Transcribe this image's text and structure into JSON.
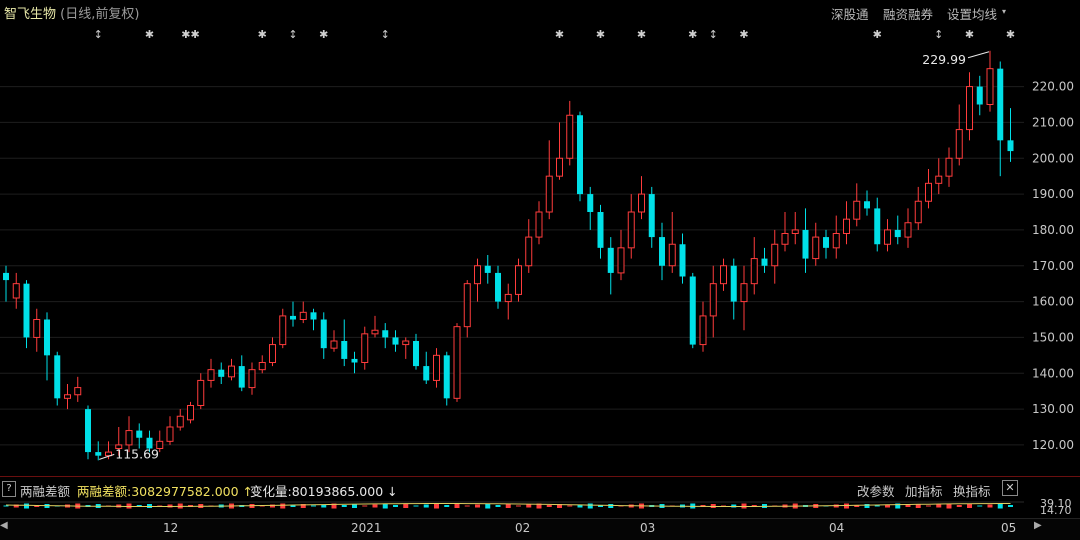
{
  "header": {
    "stock_name": "智飞生物",
    "mode": "(日线,前复权)",
    "links": [
      "深股通",
      "融资融券",
      "设置均线"
    ]
  },
  "chart_data": {
    "type": "candlestick",
    "y_ticks": [
      "220.00",
      "210.00",
      "200.00",
      "190.00",
      "180.00",
      "170.00",
      "160.00",
      "150.00",
      "140.00",
      "130.00",
      "120.00"
    ],
    "ylim": [
      113,
      233
    ],
    "x_labels": [
      "12",
      "2021",
      "02",
      "03",
      "04",
      "05"
    ],
    "high_label": "229.99",
    "low_label": "115.69",
    "event_markers": [
      {
        "index": 9,
        "symbol": "↕"
      },
      {
        "index": 14,
        "symbol": "✱"
      },
      {
        "index": 18,
        "symbol": "✱✱"
      },
      {
        "index": 25,
        "symbol": "✱"
      },
      {
        "index": 28,
        "symbol": "↕"
      },
      {
        "index": 31,
        "symbol": "✱"
      },
      {
        "index": 37,
        "symbol": "↕"
      },
      {
        "index": 54,
        "symbol": "✱"
      },
      {
        "index": 58,
        "symbol": "✱"
      },
      {
        "index": 62,
        "symbol": "✱"
      },
      {
        "index": 67,
        "symbol": "✱"
      },
      {
        "index": 69,
        "symbol": "↕"
      },
      {
        "index": 72,
        "symbol": "✱"
      },
      {
        "index": 85,
        "symbol": "✱"
      },
      {
        "index": 91,
        "symbol": "↕"
      },
      {
        "index": 94,
        "symbol": "✱"
      },
      {
        "index": 98,
        "symbol": "✱"
      }
    ],
    "candles": [
      [
        168,
        166,
        170,
        160
      ],
      [
        161,
        165,
        168,
        158
      ],
      [
        165,
        150,
        166,
        147
      ],
      [
        150,
        155,
        158,
        146
      ],
      [
        155,
        145,
        157,
        138
      ],
      [
        145,
        133,
        146,
        131
      ],
      [
        133,
        134,
        137,
        130
      ],
      [
        134,
        136,
        139,
        132
      ],
      [
        130,
        118,
        131,
        116
      ],
      [
        118,
        117,
        121,
        115.69
      ],
      [
        117,
        118,
        121,
        116
      ],
      [
        119,
        120,
        125,
        117
      ],
      [
        120,
        124,
        128,
        118
      ],
      [
        124,
        122,
        126,
        119
      ],
      [
        122,
        119,
        124,
        118
      ],
      [
        119,
        121,
        124,
        118
      ],
      [
        121,
        125,
        128,
        120
      ],
      [
        125,
        128,
        130,
        124
      ],
      [
        127,
        131,
        132,
        126
      ],
      [
        131,
        138,
        140,
        130
      ],
      [
        138,
        141,
        144,
        136
      ],
      [
        141,
        139,
        143,
        137
      ],
      [
        139,
        142,
        144,
        138
      ],
      [
        142,
        136,
        145,
        135
      ],
      [
        136,
        141,
        143,
        134
      ],
      [
        141,
        143,
        145,
        140
      ],
      [
        143,
        148,
        150,
        142
      ],
      [
        148,
        156,
        158,
        147
      ],
      [
        156,
        155,
        160,
        153
      ],
      [
        155,
        157,
        160,
        154
      ],
      [
        157,
        155,
        158,
        152
      ],
      [
        155,
        147,
        157,
        144
      ],
      [
        147,
        149,
        152,
        146
      ],
      [
        149,
        144,
        155,
        142
      ],
      [
        144,
        143,
        146,
        140
      ],
      [
        143,
        151,
        153,
        141
      ],
      [
        151,
        152,
        156,
        150
      ],
      [
        152,
        150,
        154,
        147
      ],
      [
        150,
        148,
        152,
        146
      ],
      [
        148,
        149,
        150,
        144
      ],
      [
        149,
        142,
        151,
        141
      ],
      [
        142,
        138,
        146,
        137
      ],
      [
        138,
        145,
        147,
        136
      ],
      [
        145,
        133,
        146,
        131
      ],
      [
        133,
        153,
        154,
        132
      ],
      [
        153,
        165,
        166,
        150
      ],
      [
        165,
        170,
        172,
        160
      ],
      [
        170,
        168,
        173,
        165
      ],
      [
        168,
        160,
        170,
        158
      ],
      [
        160,
        162,
        165,
        155
      ],
      [
        162,
        170,
        172,
        160
      ],
      [
        170,
        178,
        183,
        168
      ],
      [
        178,
        185,
        188,
        176
      ],
      [
        185,
        195,
        205,
        183
      ],
      [
        195,
        200,
        210,
        194
      ],
      [
        200,
        212,
        216,
        198
      ],
      [
        212,
        190,
        213,
        188
      ],
      [
        190,
        185,
        192,
        180
      ],
      [
        185,
        175,
        187,
        172
      ],
      [
        175,
        168,
        178,
        162
      ],
      [
        168,
        175,
        180,
        166
      ],
      [
        175,
        185,
        190,
        172
      ],
      [
        185,
        190,
        195,
        183
      ],
      [
        190,
        178,
        192,
        175
      ],
      [
        178,
        170,
        182,
        166
      ],
      [
        170,
        176,
        185,
        168
      ],
      [
        176,
        167,
        179,
        165
      ],
      [
        167,
        148,
        168,
        147
      ],
      [
        148,
        156,
        160,
        146
      ],
      [
        156,
        165,
        170,
        150
      ],
      [
        165,
        170,
        172,
        163
      ],
      [
        170,
        160,
        172,
        155
      ],
      [
        160,
        165,
        170,
        152
      ],
      [
        165,
        172,
        178,
        162
      ],
      [
        172,
        170,
        175,
        168
      ],
      [
        170,
        176,
        180,
        165
      ],
      [
        176,
        179,
        185,
        174
      ],
      [
        179,
        180,
        185,
        176
      ],
      [
        180,
        172,
        186,
        168
      ],
      [
        172,
        178,
        182,
        170
      ],
      [
        178,
        175,
        180,
        172
      ],
      [
        175,
        179,
        184,
        172
      ],
      [
        179,
        183,
        188,
        176
      ],
      [
        183,
        188,
        193,
        181
      ],
      [
        188,
        186,
        191,
        184
      ],
      [
        186,
        176,
        189,
        174
      ],
      [
        176,
        180,
        183,
        174
      ],
      [
        180,
        178,
        184,
        176
      ],
      [
        178,
        182,
        186,
        175
      ],
      [
        182,
        188,
        192,
        180
      ],
      [
        188,
        193,
        197,
        186
      ],
      [
        193,
        195,
        200,
        190
      ],
      [
        195,
        200,
        203,
        192
      ],
      [
        200,
        208,
        215,
        198
      ],
      [
        208,
        220,
        224,
        205
      ],
      [
        220,
        215,
        223,
        212
      ],
      [
        215,
        225,
        229.99,
        213
      ],
      [
        225,
        205,
        227,
        195
      ],
      [
        205,
        202,
        214,
        199
      ]
    ],
    "indicator": {
      "name": "两融差额",
      "value_text": "两融差额:3082977582.000 ↑",
      "change_text": "变化量:80193865.000 ↓",
      "buttons": [
        "改参数",
        "加指标",
        "换指标"
      ],
      "y_ticks": [
        "39.10",
        "14.70"
      ]
    }
  },
  "colors": {
    "up": "#ff3c3c",
    "down": "#00e0e8",
    "indicator_line": "#e0d060"
  },
  "icons": {
    "help": "?",
    "close": "✕",
    "scroll_left": "◀",
    "scroll_right": "▶",
    "dropdown": "▾"
  }
}
